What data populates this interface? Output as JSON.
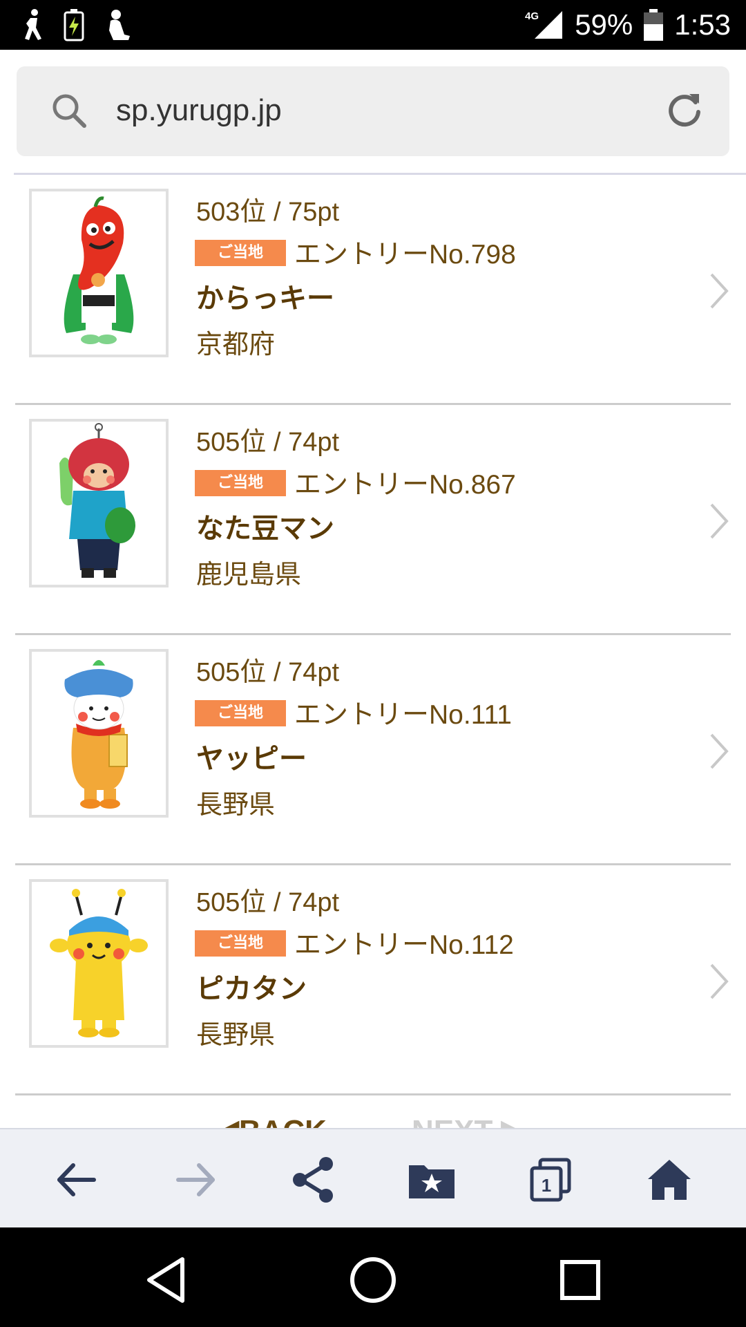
{
  "status_bar": {
    "network": "4G",
    "battery": "59%",
    "time": "1:53"
  },
  "browser": {
    "url": "sp.yurugp.jp"
  },
  "colors": {
    "brand_text": "#6b4a10",
    "badge": "#f58a4c",
    "toolbar_icon": "#2e3a59"
  },
  "items": [
    {
      "rank": "503位 / 75pt",
      "badge": "ご当地",
      "entry": "エントリーNo.798",
      "name": "からっキー",
      "prefecture": "京都府"
    },
    {
      "rank": "505位 / 74pt",
      "badge": "ご当地",
      "entry": "エントリーNo.867",
      "name": "なた豆マン",
      "prefecture": "鹿児島県"
    },
    {
      "rank": "505位 / 74pt",
      "badge": "ご当地",
      "entry": "エントリーNo.111",
      "name": "ヤッピー",
      "prefecture": "長野県"
    },
    {
      "rank": "505位 / 74pt",
      "badge": "ご当地",
      "entry": "エントリーNo.112",
      "name": "ピカタン",
      "prefecture": "長野県"
    }
  ],
  "pager": {
    "back": "◀BACK",
    "next": "NEXT ▶"
  },
  "toolbar": {
    "tab_count": "1"
  }
}
